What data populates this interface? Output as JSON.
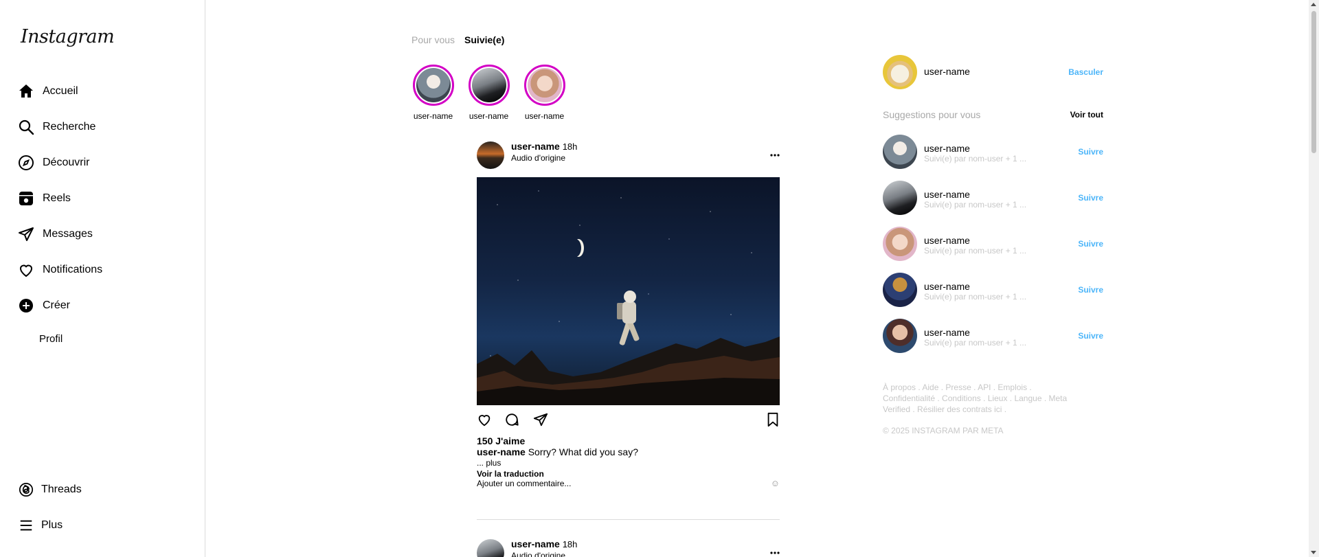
{
  "app": {
    "logo_text": "Instagram"
  },
  "sidebar": {
    "items": [
      {
        "label": "Accueil",
        "icon": "home-icon"
      },
      {
        "label": "Recherche",
        "icon": "search-icon"
      },
      {
        "label": "Découvrir",
        "icon": "compass-icon"
      },
      {
        "label": "Reels",
        "icon": "reels-icon"
      },
      {
        "label": "Messages",
        "icon": "send-icon"
      },
      {
        "label": "Notifications",
        "icon": "heart-icon"
      },
      {
        "label": "Créer",
        "icon": "plus-circle-icon"
      },
      {
        "label": "Profil",
        "icon": ""
      }
    ],
    "bottom": [
      {
        "label": "Threads",
        "icon": "threads-icon"
      },
      {
        "label": "Plus",
        "icon": "menu-icon"
      }
    ]
  },
  "feed": {
    "tabs": [
      {
        "label": "Pour vous",
        "active": false
      },
      {
        "label": "Suivie(e)",
        "active": true
      }
    ],
    "stories": [
      {
        "username": "user-name"
      },
      {
        "username": "user-name"
      },
      {
        "username": "user-name"
      }
    ],
    "post": {
      "username": "user-name",
      "time": "18h",
      "audio": "Audio d'origine",
      "likes": "150 J'aime",
      "caption_user": "user-name",
      "caption_text": " Sorry? What did you say?",
      "more": "... plus",
      "translate": "Voir la traduction",
      "comment_placeholder": "Ajouter un commentaire...",
      "emoji": "☺"
    },
    "next_post": {
      "username": "user-name",
      "time": "18h",
      "audio": "Audio d'origine"
    }
  },
  "right": {
    "me": {
      "username": "user-name",
      "switch_label": "Basculer"
    },
    "suggestions_title": "Suggestions pour vous",
    "see_all": "Voir tout",
    "suggestions": [
      {
        "username": "user-name",
        "sub": "Suivi(e) par nom-user + 1 ...",
        "action": "Suivre"
      },
      {
        "username": "user-name",
        "sub": "Suivi(e) par nom-user + 1 ...",
        "action": "Suivre"
      },
      {
        "username": "user-name",
        "sub": "Suivi(e) par nom-user + 1 ...",
        "action": "Suivre"
      },
      {
        "username": "user-name",
        "sub": "Suivi(e) par nom-user + 1 ...",
        "action": "Suivre"
      },
      {
        "username": "user-name",
        "sub": "Suivi(e) par nom-user + 1 ...",
        "action": "Suivre"
      }
    ],
    "footer_line1": "À propos . Aide . Presse . API . Emplois .",
    "footer_line2": "Confidentialité . Conditions . Lieux . Langue . Meta",
    "footer_line3": "Verified . Résilier des contrats ici .",
    "copyright": "© 2025 INSTAGRAM PAR META"
  },
  "colors": {
    "accent_blue": "#4cb5f9",
    "story_ring": "#d300c5",
    "muted_text": "#a8a8a8",
    "border": "#dbdbdb"
  }
}
